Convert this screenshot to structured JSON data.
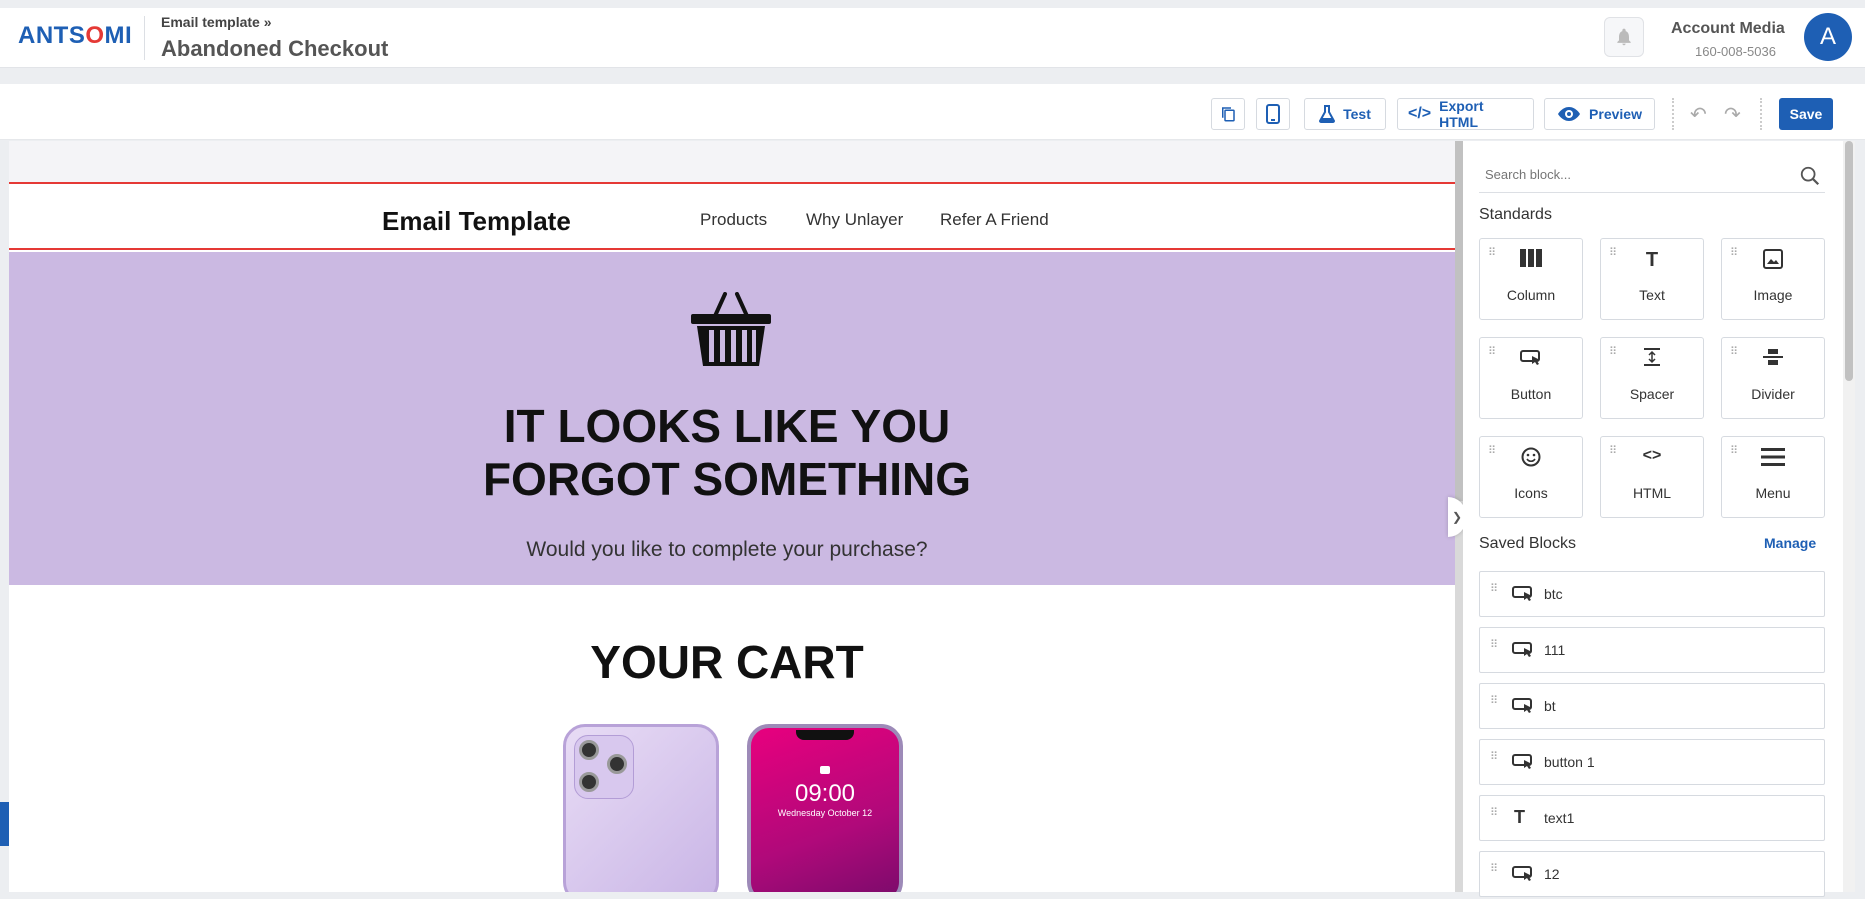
{
  "header": {
    "logo_prefix": "ANTS",
    "logo_accent": "O",
    "logo_suffix": "MI",
    "breadcrumb": "Email template »",
    "title": "Abandoned Checkout",
    "account_name": "Account Media",
    "account_id": "160-008-5036",
    "avatar_letter": "A"
  },
  "toolbar": {
    "test_label": "Test",
    "export_label": "Export HTML",
    "preview_label": "Preview",
    "save_label": "Save"
  },
  "email": {
    "brand": "Email Template",
    "nav": [
      "Products",
      "Why Unlayer",
      "Refer A Friend"
    ],
    "hero_line1": "IT LOOKS LIKE YOU",
    "hero_line2": "FORGOT SOMETHING",
    "hero_sub": "Would you like to complete your purchase?",
    "cart_title": "YOUR CART",
    "phone_time": "09:00",
    "phone_date": "Wednesday October 12"
  },
  "panel": {
    "search_placeholder": "Search block...",
    "standards_title": "Standards",
    "blocks": [
      {
        "label": "Column",
        "icon": "column-icon"
      },
      {
        "label": "Text",
        "icon": "text-icon"
      },
      {
        "label": "Image",
        "icon": "image-icon"
      },
      {
        "label": "Button",
        "icon": "button-icon"
      },
      {
        "label": "Spacer",
        "icon": "spacer-icon"
      },
      {
        "label": "Divider",
        "icon": "divider-icon"
      },
      {
        "label": "Icons",
        "icon": "smiley-icon"
      },
      {
        "label": "HTML",
        "icon": "code-icon"
      },
      {
        "label": "Menu",
        "icon": "menu-icon"
      }
    ],
    "saved_title": "Saved Blocks",
    "manage_label": "Manage",
    "saved_blocks": [
      {
        "label": "btc",
        "icon": "button-icon"
      },
      {
        "label": "111",
        "icon": "button-icon"
      },
      {
        "label": "bt",
        "icon": "button-icon"
      },
      {
        "label": "button 1",
        "icon": "button-icon"
      },
      {
        "label": "text1",
        "icon": "text-icon"
      },
      {
        "label": "12",
        "icon": "button-icon"
      }
    ]
  },
  "colors": {
    "brand_blue": "#1e5fb4",
    "accent_red": "#e53935",
    "hero_bg": "#cbb9e2"
  }
}
